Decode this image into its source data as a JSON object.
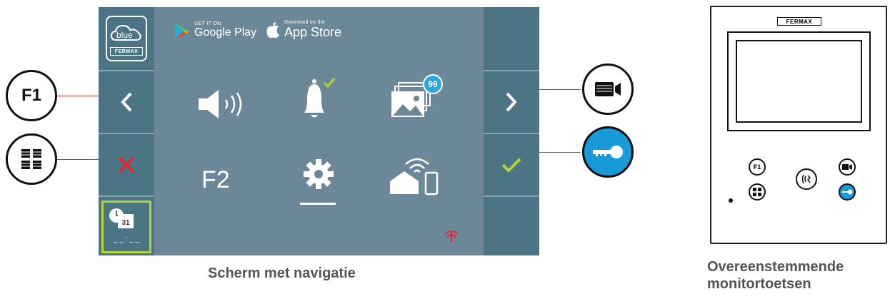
{
  "screen": {
    "store_badges": {
      "google_small": "GET IT ON",
      "google_big": "Google Play",
      "apple_small": "Download on the",
      "apple_big": "App Store"
    },
    "left_column": {
      "logo_text": "blue",
      "logo_brand": "FERMAX",
      "prev_icon": "chevron-left-icon",
      "cancel_icon": "close-icon",
      "calendar_day": "31",
      "time_placeholder": "_ _ : _ _"
    },
    "right_column": {
      "next_icon": "chevron-right-icon",
      "confirm_icon": "checkmark-icon"
    },
    "menu": {
      "volume_icon": "speaker-volume-icon",
      "notification_icon": "bell-icon",
      "gallery_badge": "99",
      "f2_label": "F2",
      "settings_icon": "gear-icon",
      "home_icon": "smart-home-icon"
    },
    "status": {
      "wifi_icon": "wifi-disconnected-icon"
    }
  },
  "outer_buttons": {
    "f1_label": "F1",
    "menu_icon": "grid-icon",
    "camera_icon": "camera-icon",
    "key_icon": "key-icon"
  },
  "monitor": {
    "brand": "FERMAX",
    "f1_label": "F1"
  },
  "captions": {
    "screen_caption": "Scherm met navigatie",
    "monitor_caption_1": "Overeenstemmende",
    "monitor_caption_2": "monitortoetsen"
  },
  "colors": {
    "screen_bg": "#6c8898",
    "side_bg": "#4b7485",
    "accent_green": "#b5d334",
    "cancel_red": "#e0282c",
    "key_blue": "#199ad8",
    "badge_blue": "#2aa7dc"
  }
}
